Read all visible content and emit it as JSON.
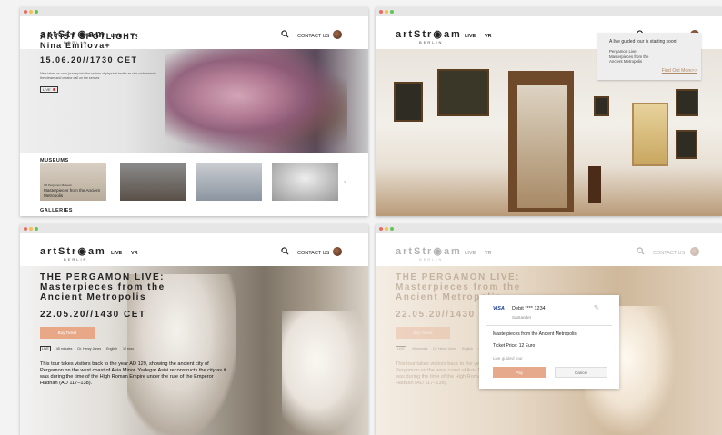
{
  "brand": {
    "name": "artStr◉am",
    "city": "BERLIN"
  },
  "nav": {
    "live": "LIVE",
    "vr": "VR",
    "contact": "CONTACT US"
  },
  "screen1": {
    "spotlight_title": "ARTIST SPOTLIGHT:",
    "spotlight_artist": "Nina Emifova+",
    "spotlight_date": "15.06.20//1730 CET",
    "spotlight_text": "Nina takes us on a journey into the realms of physical textile as she understands the viewer and creator call on the senses",
    "live_label": "LIVE",
    "museums_label": "MUSEUMS",
    "galleries_label": "GALLERIES",
    "museum_cards": [
      {
        "badge": "VR   Pergamon Museum",
        "title": "Masterpieces from the Ancient Metropolis"
      }
    ]
  },
  "screen2": {
    "popup_title": "A live guided tour is starting soon!",
    "popup_venue": "Pergamon Live:",
    "popup_line2": "Masterpieces from the",
    "popup_line3": "Ancient Metropolis",
    "popup_link": "Find Out More>>"
  },
  "screen3": {
    "title_line1": "THE PERGAMON LIVE:",
    "title_line2": "Masterpieces from the",
    "title_line3": "Ancient Metropolis",
    "date": "22.05.20//1430 CET",
    "buy_label": "Buy Ticket",
    "meta": {
      "badge": "LIVE",
      "duration": "45 minutes",
      "guide": "Dr. Henry Jones",
      "language": "English",
      "age": "12 euro"
    },
    "description": "This tour takes visitors back to the year AD 129, showing the ancient city of Pergamon on the west coast of Asia Minor. Yadegar Asisi reconstructs the city as it was during the time of the High Roman Empire under the rule of the Emperor Hadrian (AD 117–138)."
  },
  "screen4": {
    "card_brand": "VISA",
    "card_number": "Debit **** 1234",
    "bank": "Santander",
    "item": "Masterpieces from the Ancient Metropolis",
    "price": "Ticket Price: 12 Euro",
    "tour_type": "Live guided tour",
    "pay_label": "Pay",
    "cancel_label": "Cancel"
  }
}
